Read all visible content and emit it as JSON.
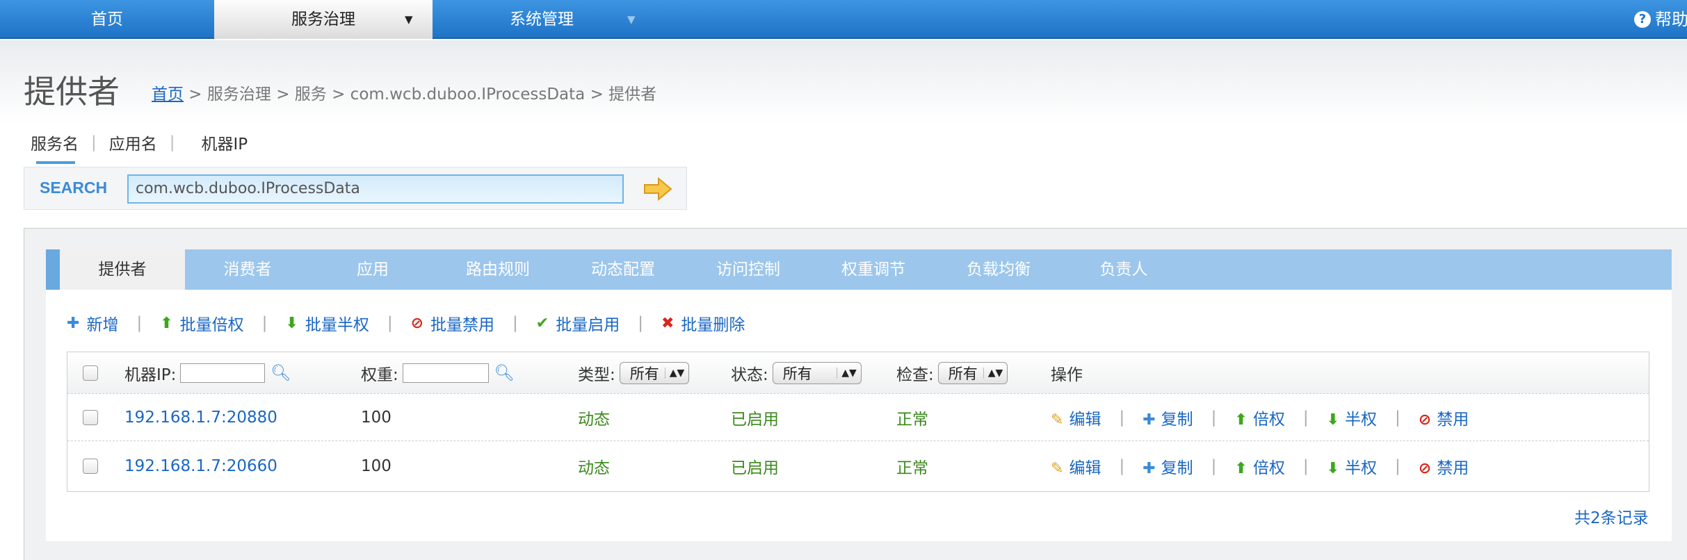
{
  "nav": {
    "home": "首页",
    "gov": "服务治理",
    "sys": "系统管理",
    "help": "帮助"
  },
  "page": {
    "title": "提供者",
    "breadcrumb_home": "首页",
    "breadcrumb_rest": " > 服务治理 > 服务 > com.wcb.duboo.IProcessData > 提供者"
  },
  "search": {
    "tabs": [
      "服务名",
      "应用名",
      "机器IP"
    ],
    "label": "SEARCH",
    "value": "com.wcb.duboo.IProcessData"
  },
  "tabs": [
    "提供者",
    "消费者",
    "应用",
    "路由规则",
    "动态配置",
    "访问控制",
    "权重调节",
    "负载均衡",
    "负责人"
  ],
  "toolbar": {
    "add": "新增",
    "double": "批量倍权",
    "half": "批量半权",
    "disable": "批量禁用",
    "enable": "批量启用",
    "delete": "批量删除"
  },
  "table": {
    "ip_label": "机器IP:",
    "weight_label": "权重:",
    "type_label": "类型:",
    "type_value": "所有",
    "status_label": "状态:",
    "status_value": "所有",
    "check_label": "检查:",
    "check_value": "所有",
    "ops_label": "操作",
    "rows": [
      {
        "ip": "192.168.1.7:20880",
        "weight": "100",
        "type": "动态",
        "status": "已启用",
        "check": "正常"
      },
      {
        "ip": "192.168.1.7:20660",
        "weight": "100",
        "type": "动态",
        "status": "已启用",
        "check": "正常"
      }
    ],
    "ops": {
      "edit": "编辑",
      "copy": "复制",
      "double": "倍权",
      "half": "半权",
      "disable": "禁用"
    }
  },
  "total": "共2条记录",
  "colors": {
    "nav": "#1f73c6",
    "tabbar": "#9cc6ec",
    "link": "#1a67c4",
    "green": "#3a8a1c",
    "red": "#d9261c"
  }
}
